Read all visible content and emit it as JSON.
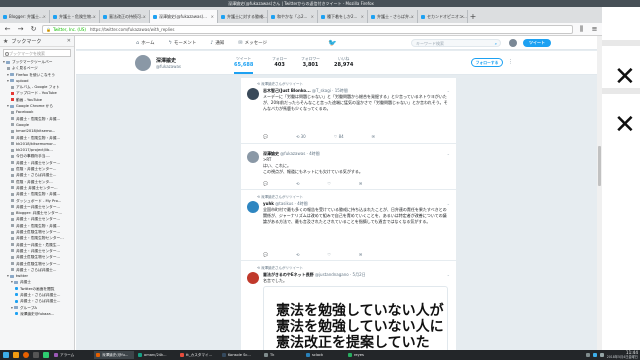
{
  "window": {
    "title": "深澤諭史(@fukazawas)さん | Twitterからの返信付きツイート - Mozilla Firefox"
  },
  "tabs": [
    {
      "label": "Blogger: 弁護士..."
    },
    {
      "label": "弁護士・危険生物..."
    },
    {
      "label": "憲法改正の持続可..."
    },
    {
      "label": "深澤諭史(@fukazawas)...",
      "active": true
    },
    {
      "label": "弁護士に対する懲戒..."
    },
    {
      "label": "和やかな「ふ2..."
    },
    {
      "label": "種下着をしか2..."
    },
    {
      "label": "弁護士・さらば弁..."
    },
    {
      "label": "セカンドオピニオン..."
    }
  ],
  "urlbar": {
    "site": "Twitter, Inc. (US)",
    "url": "https://twitter.com/fukazawas/with_replies"
  },
  "sidebar": {
    "title": "ブックマーク",
    "search_placeholder": "ブックマークを検索",
    "items": [
      {
        "label": "ブックマークツールバー",
        "icon": "folder",
        "indent": 0
      },
      {
        "label": "よく見るページ",
        "icon": "page",
        "indent": 1
      },
      {
        "label": "Firefox を使いこなそう",
        "icon": "folder",
        "indent": 1
      },
      {
        "label": "upload",
        "icon": "folder",
        "indent": 1
      },
      {
        "label": "アルバム - Google フォト",
        "icon": "page",
        "indent": 2
      },
      {
        "label": "アップロード - YouTube",
        "icon": "youtube",
        "indent": 2
      },
      {
        "label": "動画 - YouTube",
        "icon": "youtube",
        "indent": 2
      },
      {
        "label": "Google Chrome から",
        "icon": "folder",
        "indent": 1
      },
      {
        "label": "Facebook",
        "icon": "page",
        "indent": 2
      },
      {
        "label": "弁護士・危険生物・弁護...",
        "icon": "page",
        "indent": 2
      },
      {
        "label": "Google",
        "icon": "page",
        "indent": 2
      },
      {
        "label": "kmori2018/kitsemo...",
        "icon": "page",
        "indent": 2
      },
      {
        "label": "弁護士・危険生物・弁護...",
        "icon": "page",
        "indent": 2
      },
      {
        "label": "kk2018/kitsemomor...",
        "icon": "page",
        "indent": 2
      },
      {
        "label": "kk2017/project/lib...",
        "icon": "page",
        "indent": 2
      },
      {
        "label": "今日の事務所手当-...",
        "icon": "page",
        "indent": 2
      },
      {
        "label": "弁護士・弁護士センター...",
        "icon": "page",
        "indent": 2
      },
      {
        "label": "危険・弁護士センター...",
        "icon": "page",
        "indent": 2
      },
      {
        "label": "弁護士・さらば弁護士...",
        "icon": "page",
        "indent": 2
      },
      {
        "label": "危険・弁護士センタ...",
        "icon": "page",
        "indent": 2
      },
      {
        "label": "弁護士 弁護士センター...",
        "icon": "page",
        "indent": 2
      },
      {
        "label": "弁護士・危険生物・弁護...",
        "icon": "page",
        "indent": 2
      },
      {
        "label": "ダッシュボード - My Pro...",
        "icon": "page",
        "indent": 2
      },
      {
        "label": "弁護士ー弁護士センター...",
        "icon": "page",
        "indent": 2
      },
      {
        "label": "Blogger: 弁護士センター...",
        "icon": "page",
        "indent": 2
      },
      {
        "label": "弁護士・弁護士センター...",
        "icon": "page",
        "indent": 2
      },
      {
        "label": "弁護士・危険生物・弁護...",
        "icon": "page",
        "indent": 2
      },
      {
        "label": "弁護士危険生物センター...",
        "icon": "page",
        "indent": 2
      },
      {
        "label": "弁護士・危険生物センター...",
        "icon": "page",
        "indent": 2
      },
      {
        "label": "弁護士ー弁護士・危険生...",
        "icon": "page",
        "indent": 2
      },
      {
        "label": "弁護士・弁護士センター...",
        "icon": "page",
        "indent": 2
      },
      {
        "label": "弁護士危険生物センター...",
        "icon": "page",
        "indent": 2
      },
      {
        "label": "弁護士危険生物センター...",
        "icon": "page",
        "indent": 2
      },
      {
        "label": "弁護士・さらば弁護士...",
        "icon": "page",
        "indent": 2
      },
      {
        "label": "twitter",
        "icon": "folder",
        "indent": 1
      },
      {
        "label": "弁護士",
        "icon": "folder",
        "indent": 2
      },
      {
        "label": "Twitterの画面を閲覧",
        "icon": "twitter",
        "indent": 3
      },
      {
        "label": "弁護士・さらば弁護士...",
        "icon": "twitter",
        "indent": 3
      },
      {
        "label": "弁護士・さらば弁護士...",
        "icon": "twitter",
        "indent": 3
      },
      {
        "label": "グループA",
        "icon": "folder",
        "indent": 2
      },
      {
        "label": "深澤諭史@fukaza...",
        "icon": "twitter",
        "indent": 3
      }
    ]
  },
  "twitter_nav": {
    "home": "ホーム",
    "moments": "モーメント",
    "notifications": "通知",
    "messages": "メッセージ",
    "search_placeholder": "キーワード検索",
    "tweet_button": "ツイート"
  },
  "profile": {
    "name": "深澤諭史",
    "handle": "@fukazawas",
    "stats": [
      {
        "label": "ツイート",
        "value": "65,688",
        "active": true
      },
      {
        "label": "フォロー",
        "value": "403"
      },
      {
        "label": "フォロワー",
        "value": "3,801"
      },
      {
        "label": "いいね",
        "value": "28,974"
      }
    ],
    "follow_button": "フォローする"
  },
  "tweets": [
    {
      "context": "深澤諭史さんがリツイート",
      "name": "志木智己(Just Blonko...",
      "handle": "@T_skagi · 15時間",
      "text": "メーデーに「労働は問題じゃない」と「労働問題から総合を発掘する」と少言っているネトウヨがいたが、20年前だったらそんなこと言った途端に猛気の温かさで「労働問題じゃない」とか言われそう。そんなバカが馬鹿も少くなってくるの。",
      "actions": {
        "reply": "",
        "retweet": "30",
        "like": "84"
      }
    },
    {
      "context": "",
      "name": "深澤諭史",
      "handle": "@fukazawas · 4時間",
      "text": ">RT\nはい、これに。\nこの視点が、報道にもネットにも欠けている気がする。",
      "actions": {
        "reply": "",
        "retweet": "",
        "like": ""
      }
    },
    {
      "context": "深澤諭史さんがリツイート",
      "name": "yuhk",
      "handle": "@tasikus · 4時間",
      "text": "全国市町村で最も多くの報告を受けている懲戒に持ち込まれたことが、日弁連の責任を果たすべきとの関係が、ジャーナリズムは改めて組みで自己を責めていくことを、あるいは特定者が改善についての議論がある方法で、最も言及されたとされていることを指摘しても過言ではなくなる気がする。",
      "actions": {
        "reply": "",
        "retweet": "",
        "like": ""
      }
    },
    {
      "context": "深澤諭史さんがリツイート",
      "name": "憲法がきるのやEネット長野",
      "handle": "@justandnagano · 5月2日",
      "text": "名言でした。",
      "image_text": [
        "憲法を勉強していない人が",
        "憲法を勉強していない人に",
        "憲法改正を提案していた"
      ],
      "actions": {
        "reply": "",
        "retweet": "",
        "like": ""
      }
    }
  ],
  "taskbar": {
    "items": [
      {
        "label": "アラーム"
      },
      {
        "label": "深澤諭史(@fu..."
      },
      {
        "label": "omarc/24k..."
      },
      {
        "label": "tt_カスタマイ..."
      },
      {
        "label": "Konsole Sc..."
      },
      {
        "label": "Tk"
      },
      {
        "label": "sclock"
      },
      {
        "label": "reyes"
      }
    ],
    "clock_time": "11:44",
    "clock_date": "2018年5月4日金曜日"
  },
  "colors": {
    "twitter_blue": "#1da1f2",
    "titlebar": "#475057",
    "taskbar": "#232629",
    "timeline_bg": "#e6ecf0"
  }
}
